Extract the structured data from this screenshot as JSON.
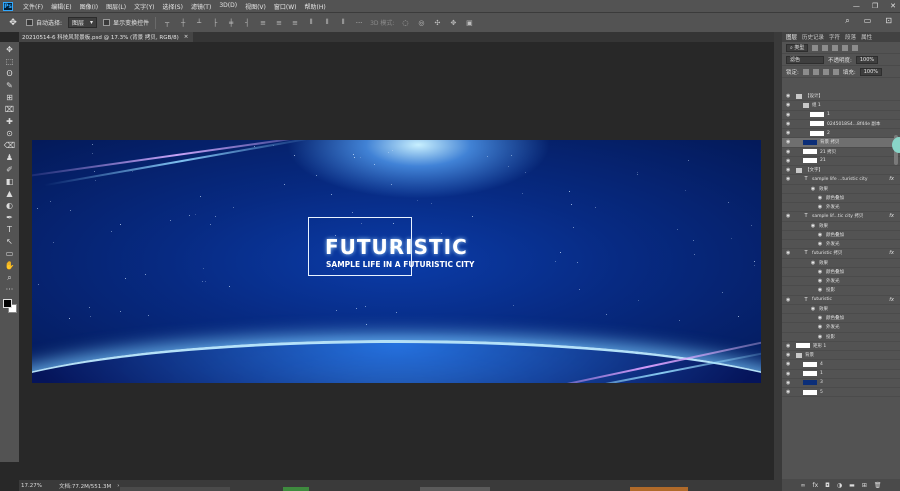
{
  "app": {
    "logo": "Ps"
  },
  "menu": [
    "文件(F)",
    "编辑(E)",
    "图像(I)",
    "图层(L)",
    "文字(Y)",
    "选择(S)",
    "滤镜(T)",
    "3D(D)",
    "视图(V)",
    "窗口(W)",
    "帮助(H)"
  ],
  "window_controls": {
    "minimize": "—",
    "restore": "❐",
    "close": "✕"
  },
  "options": {
    "move_glyph": "✥",
    "auto_select_label": "自动选择:",
    "auto_select_value": "图层",
    "show_transform_label": "显示变换控件",
    "more": "···",
    "mode_label": "3D 模式:",
    "right_icons": [
      "⌕",
      "▭",
      "⊡"
    ]
  },
  "document": {
    "tab_title": "20210514-6 科技风背景板.psd @ 17.3% (背景 拷贝, RGB/8)",
    "close": "×"
  },
  "canvas": {
    "title": "FUTURISTIC",
    "subtitle": "SAMPLE LIFE IN A FUTURISTIC CITY"
  },
  "tools": [
    "✥",
    "⬚",
    "ʘ",
    "✎",
    "⊞",
    "⌧",
    "✚",
    "⊙",
    "⌫",
    "♟",
    "✐",
    "◧",
    "▲",
    "◐",
    "✒",
    "T",
    "↖",
    "▭",
    "✋",
    "⌕",
    "···"
  ],
  "panel": {
    "tabs": [
      "图层",
      "历史记录",
      "字符",
      "段落",
      "属性"
    ],
    "filter_label": "类型",
    "blend_mode": "滤色",
    "opacity_label": "不透明度:",
    "opacity_value": "100%",
    "lock_label": "锁定:",
    "fill_label": "填充:",
    "fill_value": "100%",
    "layers": [
      {
        "kind": "folder",
        "name": "【设计】",
        "indent": 0,
        "fx": ""
      },
      {
        "kind": "folder",
        "name": "组 1",
        "indent": 1,
        "fx": ""
      },
      {
        "kind": "thumb",
        "name": "1",
        "indent": 2,
        "fx": ""
      },
      {
        "kind": "thumb",
        "name": "0245018S4...8f44e 副本",
        "indent": 2,
        "fx": ""
      },
      {
        "kind": "thumb",
        "name": "2",
        "indent": 2,
        "fx": ""
      },
      {
        "kind": "thumb-dark",
        "name": "背景 拷贝",
        "indent": 1,
        "fx": "",
        "selected": true
      },
      {
        "kind": "thumb",
        "name": "21 拷贝",
        "indent": 1,
        "fx": ""
      },
      {
        "kind": "thumb",
        "name": "21",
        "indent": 1,
        "fx": ""
      },
      {
        "kind": "folder",
        "name": "【文字】",
        "indent": 0,
        "fx": ""
      },
      {
        "kind": "text",
        "name": "sample life ...turistic city",
        "indent": 1,
        "fx": "fx"
      },
      {
        "kind": "effect",
        "name": "效果",
        "indent": 2,
        "fx": ""
      },
      {
        "kind": "effect",
        "name": "颜色叠加",
        "indent": 3,
        "fx": ""
      },
      {
        "kind": "effect",
        "name": "外发光",
        "indent": 3,
        "fx": ""
      },
      {
        "kind": "text",
        "name": "sample lif...tic city 拷贝",
        "indent": 1,
        "fx": "fx"
      },
      {
        "kind": "effect",
        "name": "效果",
        "indent": 2,
        "fx": ""
      },
      {
        "kind": "effect",
        "name": "颜色叠加",
        "indent": 3,
        "fx": ""
      },
      {
        "kind": "effect",
        "name": "外发光",
        "indent": 3,
        "fx": ""
      },
      {
        "kind": "text",
        "name": "futuristic 拷贝",
        "indent": 1,
        "fx": "fx"
      },
      {
        "kind": "effect",
        "name": "效果",
        "indent": 2,
        "fx": ""
      },
      {
        "kind": "effect",
        "name": "颜色叠加",
        "indent": 3,
        "fx": ""
      },
      {
        "kind": "effect",
        "name": "外发光",
        "indent": 3,
        "fx": ""
      },
      {
        "kind": "effect",
        "name": "投影",
        "indent": 3,
        "fx": ""
      },
      {
        "kind": "text",
        "name": "futuristic",
        "indent": 1,
        "fx": "fx"
      },
      {
        "kind": "effect",
        "name": "效果",
        "indent": 2,
        "fx": ""
      },
      {
        "kind": "effect",
        "name": "颜色叠加",
        "indent": 3,
        "fx": ""
      },
      {
        "kind": "effect",
        "name": "外发光",
        "indent": 3,
        "fx": ""
      },
      {
        "kind": "effect",
        "name": "投影",
        "indent": 3,
        "fx": ""
      },
      {
        "kind": "thumb",
        "name": "矩形 1",
        "indent": 0,
        "fx": ""
      },
      {
        "kind": "folder",
        "name": "背景",
        "indent": 0,
        "fx": ""
      },
      {
        "kind": "thumb",
        "name": "4",
        "indent": 1,
        "fx": ""
      },
      {
        "kind": "thumb",
        "name": "1",
        "indent": 1,
        "fx": ""
      },
      {
        "kind": "thumb-dark",
        "name": "3",
        "indent": 1,
        "fx": ""
      },
      {
        "kind": "thumb",
        "name": "5",
        "indent": 1,
        "fx": ""
      }
    ],
    "bottom_icons": [
      "∞",
      "fx",
      "◘",
      "◑",
      "▬",
      "⊞",
      "🗑"
    ]
  },
  "status": {
    "zoom": "17.27%",
    "doc_info": "文档:77.2M/551.3M",
    "arrow": "›"
  },
  "colors": {
    "accent_blue": "#31a8ff",
    "selected_layer": "#6f6f6f",
    "artboard_blue": "#0b3ca8"
  }
}
